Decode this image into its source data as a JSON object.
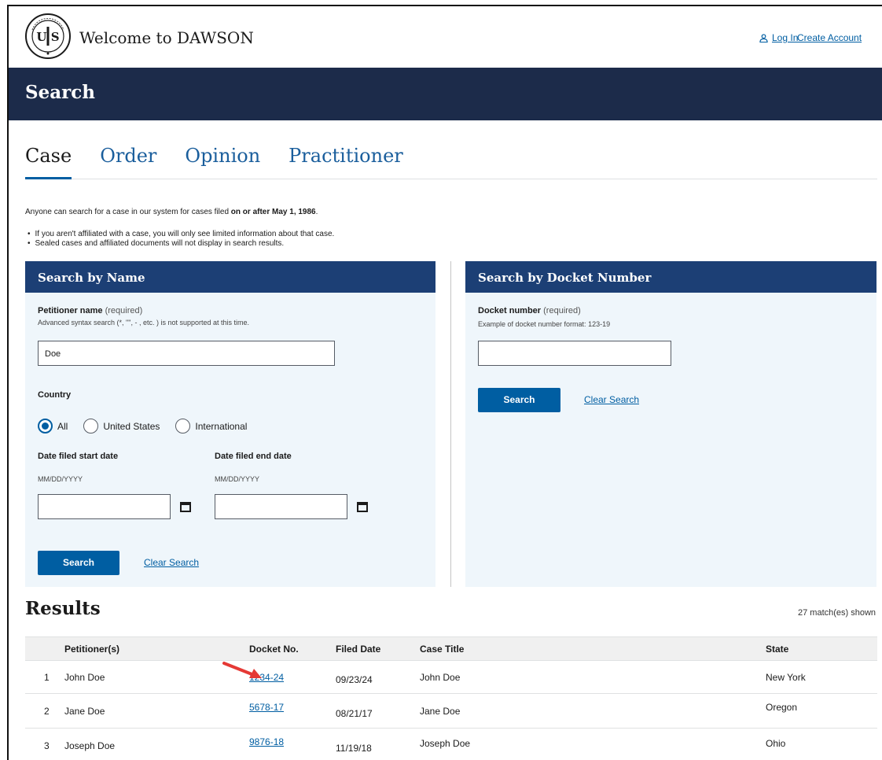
{
  "header": {
    "site_title": "Welcome to DAWSON",
    "login_label": "Log In",
    "create_account_label": "Create Account"
  },
  "page_title": "Search",
  "tabs": [
    {
      "label": "Case",
      "active": true
    },
    {
      "label": "Order",
      "active": false
    },
    {
      "label": "Opinion",
      "active": false
    },
    {
      "label": "Practitioner",
      "active": false
    }
  ],
  "intro": {
    "text": "Anyone can search for a case in our system for cases filed ",
    "bold": "on or after May 1, 1986",
    "end": ".",
    "bullets": [
      "If you aren't affiliated with a case, you will only see limited information about that case.",
      "Sealed cases and affiliated documents will not display in search results."
    ]
  },
  "search_by_name": {
    "heading": "Search by Name",
    "petitioner_label": "Petitioner name",
    "required_text": "(required)",
    "petitioner_hint": "Advanced syntax search (*, \"\", - , etc. ) is not supported at this time.",
    "petitioner_value": "Doe",
    "country_label": "Country",
    "country_options": [
      "All",
      "United States",
      "International"
    ],
    "country_selected": "All",
    "start_date_label": "Date filed start date",
    "end_date_label": "Date filed end date",
    "date_format": "MM/DD/YYYY",
    "search_label": "Search",
    "clear_label": "Clear Search"
  },
  "search_by_docket": {
    "heading": "Search by Docket Number",
    "docket_label": "Docket number",
    "required_text": "(required)",
    "docket_hint": "Example of docket number format: 123-19",
    "docket_value": "",
    "search_label": "Search",
    "clear_label": "Clear Search"
  },
  "results": {
    "title": "Results",
    "match_text": "27 match(es) shown",
    "columns": [
      "",
      "Petitioner(s)",
      "Docket No.",
      "Filed Date",
      "Case Title",
      "State"
    ],
    "rows": [
      {
        "index": "1",
        "petitioner": "John Doe",
        "docket": "1234-24",
        "filed": "09/23/24",
        "title": "John Doe",
        "state": "New York"
      },
      {
        "index": "2",
        "petitioner": "Jane Doe",
        "docket": "5678-17",
        "filed": "08/21/17",
        "title": "Jane Doe",
        "state": "Oregon"
      },
      {
        "index": "3",
        "petitioner": "Joseph Doe",
        "docket": "9876-18",
        "filed": "11/19/18",
        "title": "Joseph Doe",
        "state": "Ohio"
      }
    ]
  },
  "colors": {
    "banner": "#1c2b4a",
    "panel_header": "#1c3f75",
    "panel_bg": "#eff6fb",
    "link": "#005ea2",
    "button": "#005ea2",
    "annotation_arrow": "#e53935"
  }
}
